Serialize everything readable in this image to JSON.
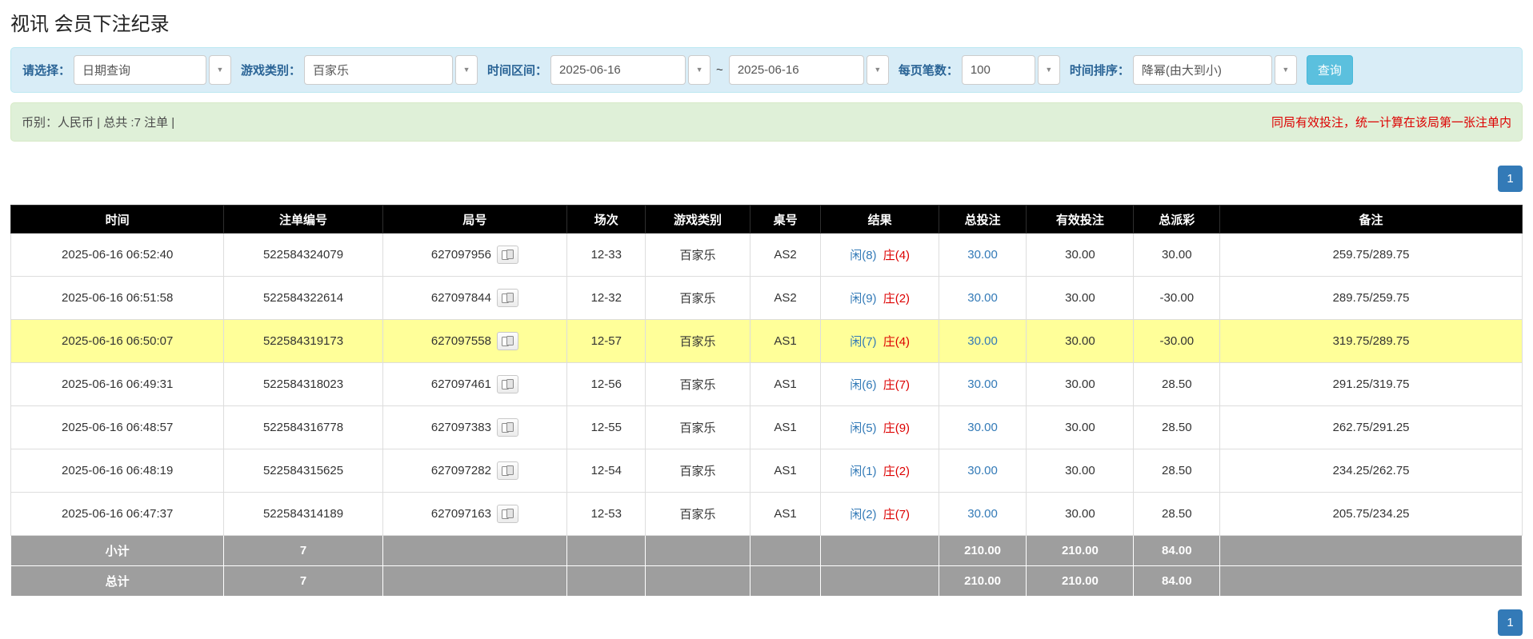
{
  "page": {
    "title": "视讯 会员下注纪录"
  },
  "colors": {
    "accent_blue": "#337ab7",
    "player_blue": "#337ab7",
    "banker_red": "#dd0000",
    "negative_red": "#dd0000",
    "note_red": "#dd0000",
    "highlight_yellow": "#ffff99",
    "header_black": "#000000",
    "footer_gray": "#9e9e9e",
    "filter_bg": "#d9edf7",
    "summary_bg": "#dff0d8",
    "search_button_bg": "#5bc0de"
  },
  "icons": {
    "dropdown_caret": "▼",
    "round_detail": "cards-icon"
  },
  "filter": {
    "select_label": "请选择：",
    "select_value": "日期查询",
    "game_type_label": "游戏类别：",
    "game_type_value": "百家乐",
    "time_range_label": "时间区间：",
    "date_from": "2025-06-16",
    "range_separator": "~",
    "date_to": "2025-06-16",
    "page_size_label": "每页笔数：",
    "page_size_value": "100",
    "sort_label": "时间排序：",
    "sort_value": "降幂(由大到小)",
    "search_button": "查询"
  },
  "summary": {
    "left": "币别：人民币 | 总共 :7 注单 |",
    "note": "同局有效投注，统一计算在该局第一张注单内"
  },
  "pagination": {
    "current_page": "1"
  },
  "table": {
    "headers": [
      "时间",
      "注单编号",
      "局号",
      "场次",
      "游戏类别",
      "桌号",
      "结果",
      "总投注",
      "有效投注",
      "总派彩",
      "备注"
    ],
    "rows": [
      {
        "time": "2025-06-16 06:52:40",
        "bet_id": "522584324079",
        "round_id": "627097956",
        "session": "12-33",
        "game": "百家乐",
        "table_no": "AS2",
        "result_player": "闲(8)",
        "result_banker": "庄(4)",
        "total_bet": "30.00",
        "valid_bet": "30.00",
        "payout": "30.00",
        "payout_negative": false,
        "remark": "259.75/289.75",
        "highlight": false
      },
      {
        "time": "2025-06-16 06:51:58",
        "bet_id": "522584322614",
        "round_id": "627097844",
        "session": "12-32",
        "game": "百家乐",
        "table_no": "AS2",
        "result_player": "闲(9)",
        "result_banker": "庄(2)",
        "total_bet": "30.00",
        "valid_bet": "30.00",
        "payout": "-30.00",
        "payout_negative": true,
        "remark": "289.75/259.75",
        "highlight": false
      },
      {
        "time": "2025-06-16 06:50:07",
        "bet_id": "522584319173",
        "round_id": "627097558",
        "session": "12-57",
        "game": "百家乐",
        "table_no": "AS1",
        "result_player": "闲(7)",
        "result_banker": "庄(4)",
        "total_bet": "30.00",
        "valid_bet": "30.00",
        "payout": "-30.00",
        "payout_negative": true,
        "remark": "319.75/289.75",
        "highlight": true
      },
      {
        "time": "2025-06-16 06:49:31",
        "bet_id": "522584318023",
        "round_id": "627097461",
        "session": "12-56",
        "game": "百家乐",
        "table_no": "AS1",
        "result_player": "闲(6)",
        "result_banker": "庄(7)",
        "total_bet": "30.00",
        "valid_bet": "30.00",
        "payout": "28.50",
        "payout_negative": false,
        "remark": "291.25/319.75",
        "highlight": false
      },
      {
        "time": "2025-06-16 06:48:57",
        "bet_id": "522584316778",
        "round_id": "627097383",
        "session": "12-55",
        "game": "百家乐",
        "table_no": "AS1",
        "result_player": "闲(5)",
        "result_banker": "庄(9)",
        "total_bet": "30.00",
        "valid_bet": "30.00",
        "payout": "28.50",
        "payout_negative": false,
        "remark": "262.75/291.25",
        "highlight": false
      },
      {
        "time": "2025-06-16 06:48:19",
        "bet_id": "522584315625",
        "round_id": "627097282",
        "session": "12-54",
        "game": "百家乐",
        "table_no": "AS1",
        "result_player": "闲(1)",
        "result_banker": "庄(2)",
        "total_bet": "30.00",
        "valid_bet": "30.00",
        "payout": "28.50",
        "payout_negative": false,
        "remark": "234.25/262.75",
        "highlight": false
      },
      {
        "time": "2025-06-16 06:47:37",
        "bet_id": "522584314189",
        "round_id": "627097163",
        "session": "12-53",
        "game": "百家乐",
        "table_no": "AS1",
        "result_player": "闲(2)",
        "result_banker": "庄(7)",
        "total_bet": "30.00",
        "valid_bet": "30.00",
        "payout": "28.50",
        "payout_negative": false,
        "remark": "205.75/234.25",
        "highlight": false
      }
    ],
    "subtotal": {
      "label": "小计",
      "count": "7",
      "total_bet": "210.00",
      "valid_bet": "210.00",
      "payout": "84.00"
    },
    "total": {
      "label": "总计",
      "count": "7",
      "total_bet": "210.00",
      "valid_bet": "210.00",
      "payout": "84.00"
    }
  }
}
